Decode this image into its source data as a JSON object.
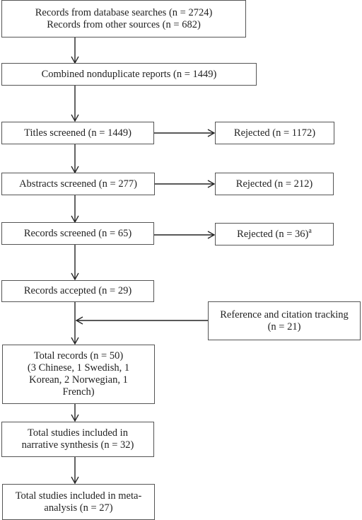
{
  "flowchart": {
    "identification": [
      "Records from database searches (n = 2724)",
      "Records from other sources (n = 682)"
    ],
    "combined": "Combined nonduplicate reports (n = 1449)",
    "titles_screened": "Titles screened (n = 1449)",
    "titles_rejected": "Rejected (n = 1172)",
    "abstracts_screened": "Abstracts screened (n = 277)",
    "abstracts_rejected": "Rejected (n = 212)",
    "records_screened": "Records screened (n = 65)",
    "records_rejected": "Rejected (n = 36)",
    "records_rejected_footnote": "a",
    "records_accepted": "Records accepted (n = 29)",
    "reference_tracking": [
      "Reference and citation tracking",
      "(n = 21)"
    ],
    "total_records": [
      "Total records (n = 50)",
      "(3 Chinese, 1 Swedish, 1",
      "Korean, 2 Norwegian, 1",
      "French)"
    ],
    "narrative": [
      "Total studies included in",
      "narrative synthesis (n = 32)"
    ],
    "meta": [
      "Total studies included in meta-",
      "analysis (n = 27)"
    ]
  }
}
